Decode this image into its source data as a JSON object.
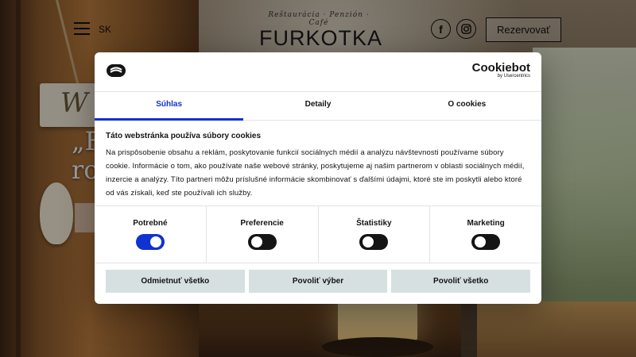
{
  "header": {
    "lang": "SK",
    "logo_sub": "Reštaurácia · Penzión · Café",
    "logo_main": "FURKOTKA",
    "reserve_label": "Rezervovať",
    "fb_glyph": "f",
    "ig_glyph": "◎"
  },
  "hero": {
    "sign_text": "W",
    "line1": "„F",
    "line2": "ro"
  },
  "cookie": {
    "brand": "Cookiebot",
    "brand_sub": "by Usercentrics",
    "tabs": [
      {
        "label": "Súhlas",
        "active": true
      },
      {
        "label": "Detaily",
        "active": false
      },
      {
        "label": "O cookies",
        "active": false
      }
    ],
    "title": "Táto webstránka používa súbory cookies",
    "text": "Na prispôsobenie obsahu a reklám, poskytovanie funkcií sociálnych médií a analýzu návštevnosti používame súbory cookie. Informácie o tom, ako používate naše webové stránky, poskytujeme aj našim partnerom v oblasti sociálnych médií, inzercie a analýzy. Títo partneri môžu príslušné informácie skombinovať s ďalšími údajmi, ktoré ste im poskytli alebo ktoré od vás získali, keď ste používali ich služby.",
    "toggles": [
      {
        "label": "Potrebné",
        "on": true
      },
      {
        "label": "Preferencie",
        "on": false
      },
      {
        "label": "Štatistiky",
        "on": false
      },
      {
        "label": "Marketing",
        "on": false
      }
    ],
    "buttons": {
      "reject": "Odmietnuť všetko",
      "allow_selection": "Povoliť výber",
      "allow_all": "Povoliť všetko"
    }
  },
  "colors": {
    "accent": "#1032cf",
    "button_bg": "#d6e0e0"
  }
}
